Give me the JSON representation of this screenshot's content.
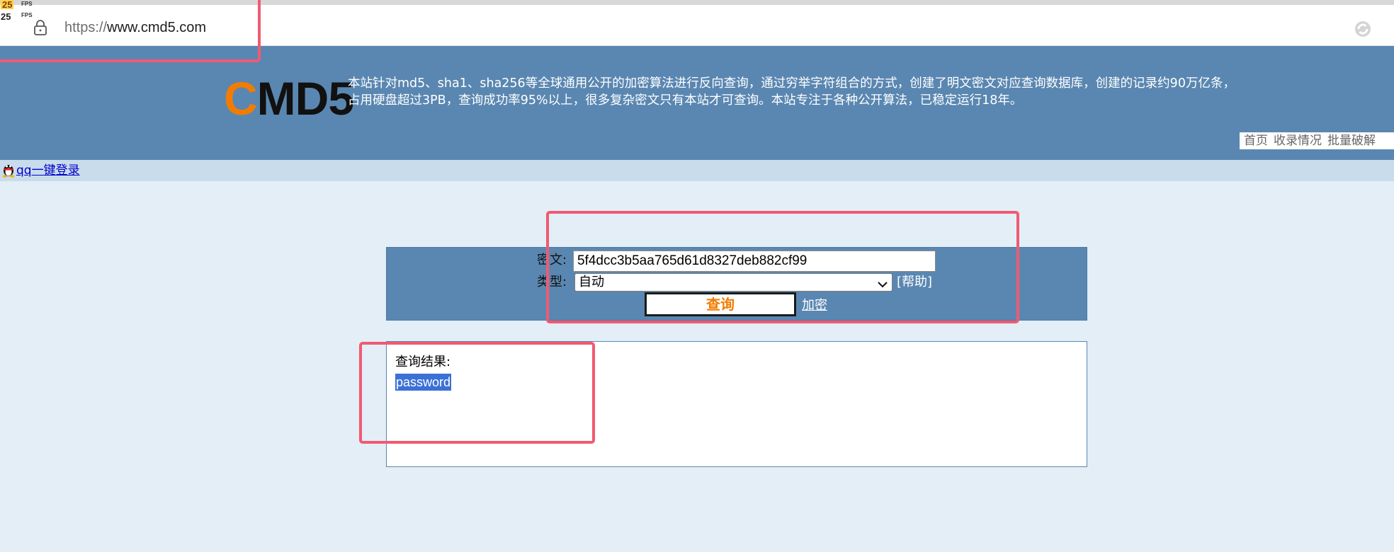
{
  "browser": {
    "url_scheme": "https://",
    "url_host": "www.cmd5.com",
    "fps_top": "25",
    "fps_bottom": "25",
    "fps_unit": "FPS",
    "lock_icon": "lock-icon",
    "refresh_icon": "refresh-icon"
  },
  "header": {
    "logo_c": "C",
    "logo_rest": "MD5",
    "description_line1": "本站针对md5、sha1、sha256等全球通用公开的加密算法进行反向查询，通过穷举字符组合的方式，创建了明文密文对应查询数据库，创建的记录约90万亿条，",
    "description_line2": "占用硬盘超过3PB，查询成功率95%以上，很多复杂密文只有本站才可查询。本站专注于各种公开算法，已稳定运行18年。",
    "nav": [
      {
        "label": "首页"
      },
      {
        "label": "收录情况"
      },
      {
        "label": "批量破解"
      }
    ]
  },
  "login": {
    "qq_label": "qq一键登录"
  },
  "form": {
    "ciphertext_label": "密文:",
    "ciphertext_value": "5f4dcc3b5aa765d61d8327deb882cf99",
    "type_label": "类型:",
    "type_value": "自动",
    "help_label": "[帮助]",
    "query_button": "查询",
    "encrypt_link": "加密"
  },
  "result": {
    "label": "查询结果:",
    "value": "password"
  },
  "colors": {
    "header_bg": "#5a87b1",
    "page_bg": "#e3eef7",
    "accent_orange": "#f27c00",
    "annotation_red": "#f05a72",
    "selection_blue": "#3b70d6"
  }
}
